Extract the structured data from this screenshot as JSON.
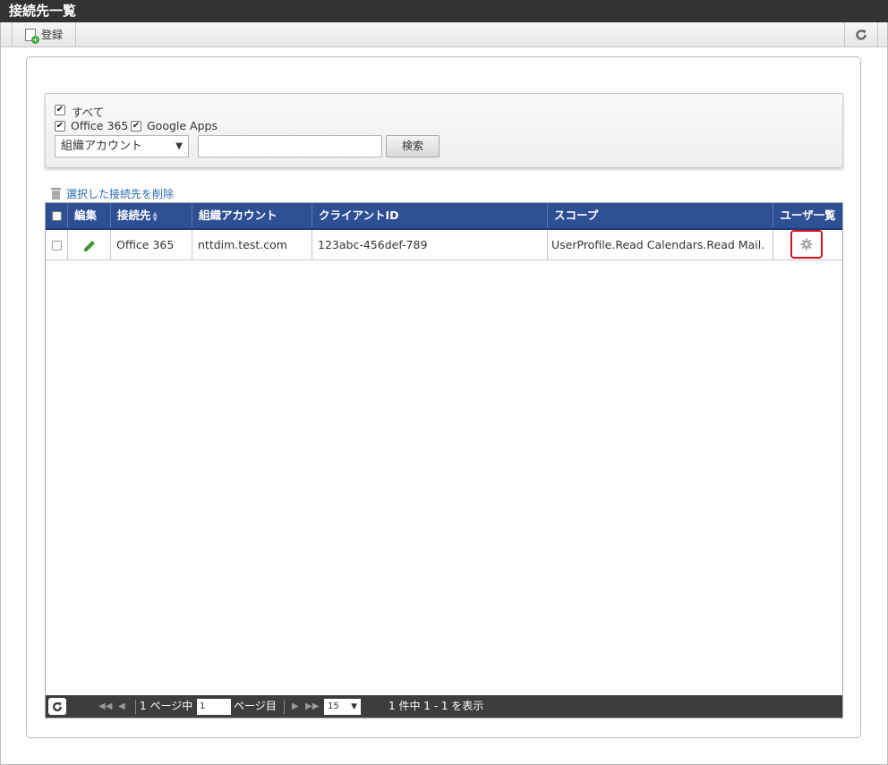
{
  "window": {
    "title": "接続先一覧"
  },
  "toolbar": {
    "register_label": "登録"
  },
  "filters": {
    "all_label": "すべて",
    "options": [
      {
        "label": "Office 365",
        "checked": true
      },
      {
        "label": "Google Apps",
        "checked": true
      }
    ],
    "all_checked": true,
    "search_field_selected": "組織アカウント",
    "search_value": "",
    "search_button": "検索"
  },
  "actions": {
    "delete_selected": "選択した接続先を削除"
  },
  "table": {
    "columns": {
      "edit": "編集",
      "connection": "接続先",
      "org_account": "組織アカウント",
      "client_id": "クライアントID",
      "scope": "スコープ",
      "user_list": "ユーザ一覧"
    },
    "rows": [
      {
        "connection": "Office 365",
        "org_account": "nttdim.test.com",
        "client_id": "123abc-456def-789",
        "scope": "UserProfile.Read Calendars.Read Mail.",
        "edit_icon": "pencil-icon",
        "user_list_icon": "gear-icon"
      }
    ]
  },
  "pager": {
    "page_prefix": "1 ページ中",
    "page_input": "1",
    "page_suffix": "ページ目",
    "page_size": "15",
    "summary": "1 件中 1 - 1 を表示"
  },
  "colors": {
    "title_bar": "#333333",
    "grid_header": "#2d4f93",
    "highlight": "#d0121b",
    "link": "#2a6cb0",
    "pager": "#3d3d3d"
  }
}
